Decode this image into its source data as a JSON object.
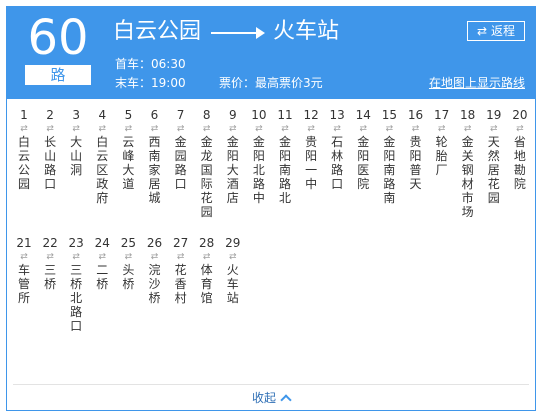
{
  "route": {
    "number": "60",
    "suffix": "路"
  },
  "from": "白云公园",
  "to": "火车站",
  "reverse_label": "返程",
  "first_bus": "首车：06:30",
  "last_bus": "末车：19:00",
  "price": "票价：最高票价3元",
  "map_link": "在地图上显示路线",
  "stops": [
    {
      "num": "1",
      "name": "白云公园"
    },
    {
      "num": "2",
      "name": "长山路口"
    },
    {
      "num": "3",
      "name": "大山洞"
    },
    {
      "num": "4",
      "name": "白云区政府"
    },
    {
      "num": "5",
      "name": "云峰大道"
    },
    {
      "num": "6",
      "name": "西南家居城"
    },
    {
      "num": "7",
      "name": "金园路口"
    },
    {
      "num": "8",
      "name": "金龙国际花园"
    },
    {
      "num": "9",
      "name": "金阳大酒店"
    },
    {
      "num": "10",
      "name": "金阳北路中"
    },
    {
      "num": "11",
      "name": "金阳南路北"
    },
    {
      "num": "12",
      "name": "贵阳一中"
    },
    {
      "num": "13",
      "name": "石林路口"
    },
    {
      "num": "14",
      "name": "金阳医院"
    },
    {
      "num": "15",
      "name": "金阳南路南"
    },
    {
      "num": "16",
      "name": "贵阳普天"
    },
    {
      "num": "17",
      "name": "轮胎厂"
    },
    {
      "num": "18",
      "name": "金关钢材市场"
    },
    {
      "num": "19",
      "name": "天然居花园"
    },
    {
      "num": "20",
      "name": "省地勘院"
    },
    {
      "num": "21",
      "name": "车管所"
    },
    {
      "num": "22",
      "name": "三桥"
    },
    {
      "num": "23",
      "name": "三桥北路口"
    },
    {
      "num": "24",
      "name": "二桥"
    },
    {
      "num": "25",
      "name": "头桥"
    },
    {
      "num": "26",
      "name": "浣沙桥"
    },
    {
      "num": "27",
      "name": "花香村"
    },
    {
      "num": "28",
      "name": "体育馆"
    },
    {
      "num": "29",
      "name": "火车站"
    }
  ],
  "collapse_label": "收起",
  "colors": {
    "header_bg": "#3f96ea",
    "text": "#333333",
    "link": "#2f6fb5"
  }
}
